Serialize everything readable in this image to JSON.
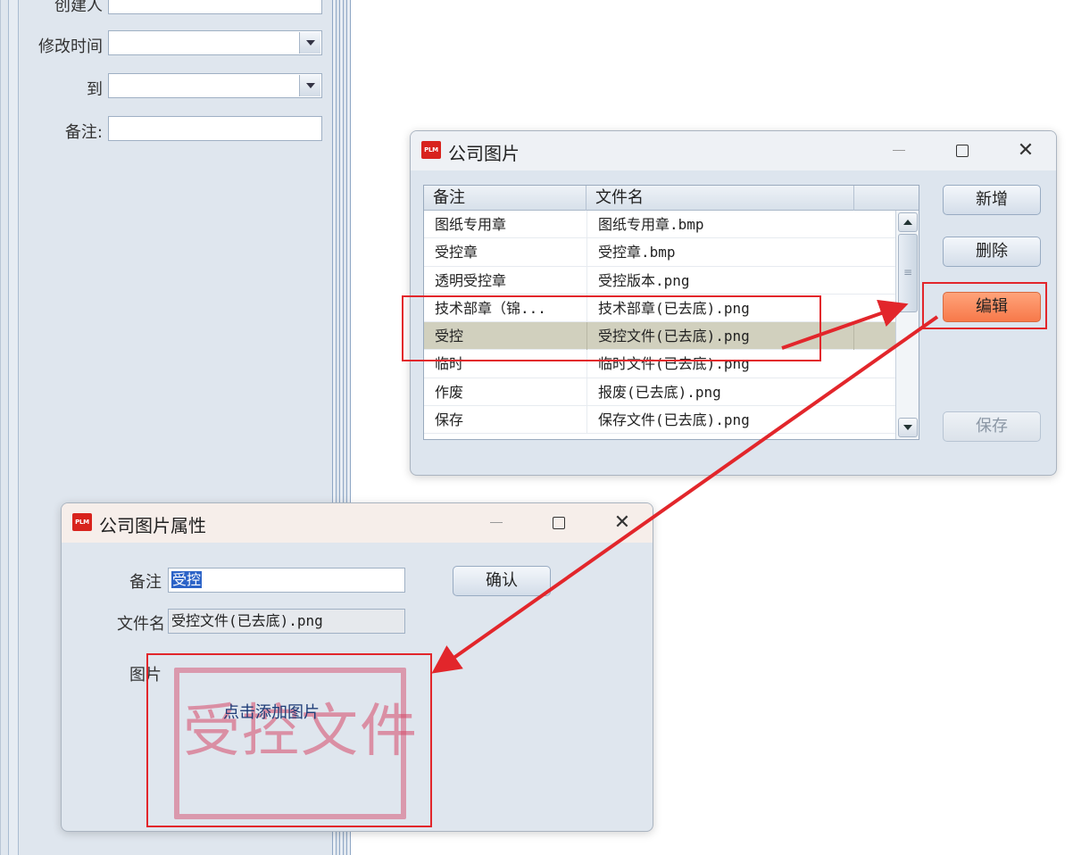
{
  "background_form": {
    "fields": [
      {
        "label": "创建人",
        "type": "text",
        "value": ""
      },
      {
        "label": "修改时间",
        "type": "select",
        "value": ""
      },
      {
        "label": "到",
        "type": "select",
        "value": ""
      },
      {
        "label": "备注:",
        "type": "text",
        "value": ""
      }
    ]
  },
  "images_window": {
    "icon_text": "PLM",
    "title": "公司图片",
    "columns": [
      "备注",
      "文件名"
    ],
    "rows": [
      {
        "note": "图纸专用章",
        "file": "图纸专用章.bmp"
      },
      {
        "note": "受控章",
        "file": "受控章.bmp"
      },
      {
        "note": "透明受控章",
        "file": "受控版本.png"
      },
      {
        "note": "技术部章（锦...",
        "file": "技术部章(已去底).png"
      },
      {
        "note": "受控",
        "file": "受控文件(已去底).png"
      },
      {
        "note": "临时",
        "file": "临时文件(已去底).png"
      },
      {
        "note": "作废",
        "file": "报废(已去底).png"
      },
      {
        "note": "保存",
        "file": "保存文件(已去底).png"
      }
    ],
    "selected_row": 4,
    "buttons": {
      "add": "新增",
      "delete": "删除",
      "edit": "编辑",
      "save": "保存"
    },
    "colors": {
      "selected_row": "#d1d0be",
      "edit_button": "#f7794a"
    }
  },
  "props_window": {
    "icon_text": "PLM",
    "title": "公司图片属性",
    "note_label": "备注",
    "note_value": "受控",
    "filename_label": "文件名",
    "filename_value": "受控文件(已去底).png",
    "image_label": "图片",
    "image_hint": "点击添加图片",
    "stamp_text": "受控文件",
    "confirm": "确认"
  },
  "annotations": {
    "color": "#e2262b"
  }
}
